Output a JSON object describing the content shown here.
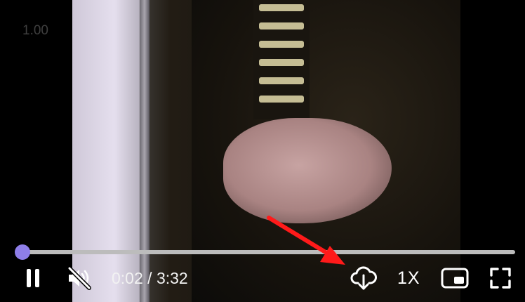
{
  "overlay": {
    "speed_text": "1.00"
  },
  "controls": {
    "play_pause_state": "playing",
    "sound_state": "muted",
    "time": {
      "current": "0:02",
      "separator": "/",
      "duration": "3:32"
    },
    "playback_rate": "1X"
  },
  "progress": {
    "fraction": 0.0,
    "color": "#8e7ee8",
    "track_color": "#bcbcbc"
  },
  "icons": {
    "pause": "pause-icon",
    "mute": "volume-muted-icon",
    "download": "cloud-download-icon",
    "pip": "picture-in-picture-icon",
    "fullscreen": "fullscreen-icon",
    "annotation": "red-arrow-icon"
  },
  "colors": {
    "accent": "#8e7ee8",
    "annotation": "#ff1a1a"
  }
}
